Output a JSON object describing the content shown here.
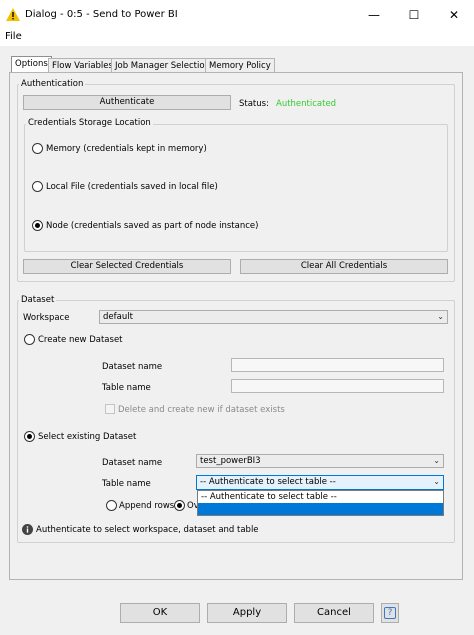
{
  "window": {
    "title": "Dialog - 0:5 - Send to Power BI",
    "minimize_glyph": "—",
    "maximize_glyph": "☐",
    "close_glyph": "✕",
    "app_icon": "warning-triangle-icon"
  },
  "menu": {
    "file": "File"
  },
  "tabs": [
    {
      "label": "Options",
      "active": true
    },
    {
      "label": "Flow Variables",
      "active": false
    },
    {
      "label": "Job Manager Selection",
      "active": false
    },
    {
      "label": "Memory Policy",
      "active": false
    }
  ],
  "authentication": {
    "legend": "Authentication",
    "authenticate_button": "Authenticate",
    "status_label": "Status:",
    "status_value": "Authenticated",
    "status_color": "#33cc33",
    "storage": {
      "legend": "Credentials Storage Location",
      "options": [
        {
          "label": "Memory (credentials kept in memory)",
          "selected": false
        },
        {
          "label": "Local File (credentials saved in local file)",
          "selected": false
        },
        {
          "label": "Node (credentials saved as part of node instance)",
          "selected": true
        }
      ]
    },
    "clear_selected_button": "Clear Selected Credentials",
    "clear_all_button": "Clear All Credentials"
  },
  "dataset": {
    "legend": "Dataset",
    "workspace_label": "Workspace",
    "workspace_value": "default",
    "create_new": {
      "label": "Create new Dataset",
      "selected": false,
      "dataset_name_label": "Dataset name",
      "dataset_name_value": "",
      "table_name_label": "Table name",
      "table_name_value": "",
      "delete_checkbox_label": "Delete and create new if dataset exists",
      "delete_checked": false
    },
    "select_existing": {
      "label": "Select existing Dataset",
      "selected": true,
      "dataset_name_label": "Dataset name",
      "dataset_name_value": "test_powerBI3",
      "table_name_label": "Table name",
      "table_name_value": "-- Authenticate to select table --",
      "dropdown_options": [
        "-- Authenticate to select table --",
        ""
      ],
      "dropdown_highlight_color": "#0078d7"
    },
    "append_rows_label": "Append rows",
    "overwrite_label_partial": "Ov",
    "info_icon": "info-icon",
    "info_text": "Authenticate to select workspace, dataset and table"
  },
  "footer": {
    "ok": "OK",
    "apply": "Apply",
    "cancel": "Cancel",
    "help_icon": "question-icon",
    "help_glyph": "?"
  }
}
